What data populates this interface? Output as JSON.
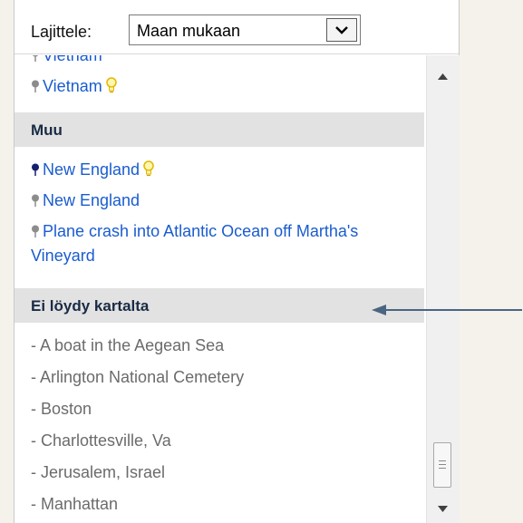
{
  "sort": {
    "label": "Lajittele:",
    "selected": "Maan mukaan"
  },
  "list": {
    "cut_item": "Vietnam",
    "top_item": "Vietnam",
    "sections": [
      {
        "title": "Muu",
        "items": [
          {
            "label": "New England",
            "pin": "dark",
            "bulb": true
          },
          {
            "label": "New England",
            "pin": "gray",
            "bulb": false
          },
          {
            "label": "Plane crash into Atlantic Ocean off Martha's Vineyard",
            "pin": "gray",
            "bulb": false
          }
        ]
      },
      {
        "title": "Ei löydy kartalta",
        "items": [
          "- A boat in the Aegean Sea",
          "- Arlington National Cemetery",
          "- Boston",
          "- Charlottesville, Va",
          "- Jerusalem, Israel",
          "- Manhattan"
        ]
      }
    ]
  },
  "colors": {
    "link": "#1a5ccf",
    "section_bg": "#e2e2e2",
    "section_text": "#1a2b45",
    "annotation_arrow": "#4a6582"
  }
}
